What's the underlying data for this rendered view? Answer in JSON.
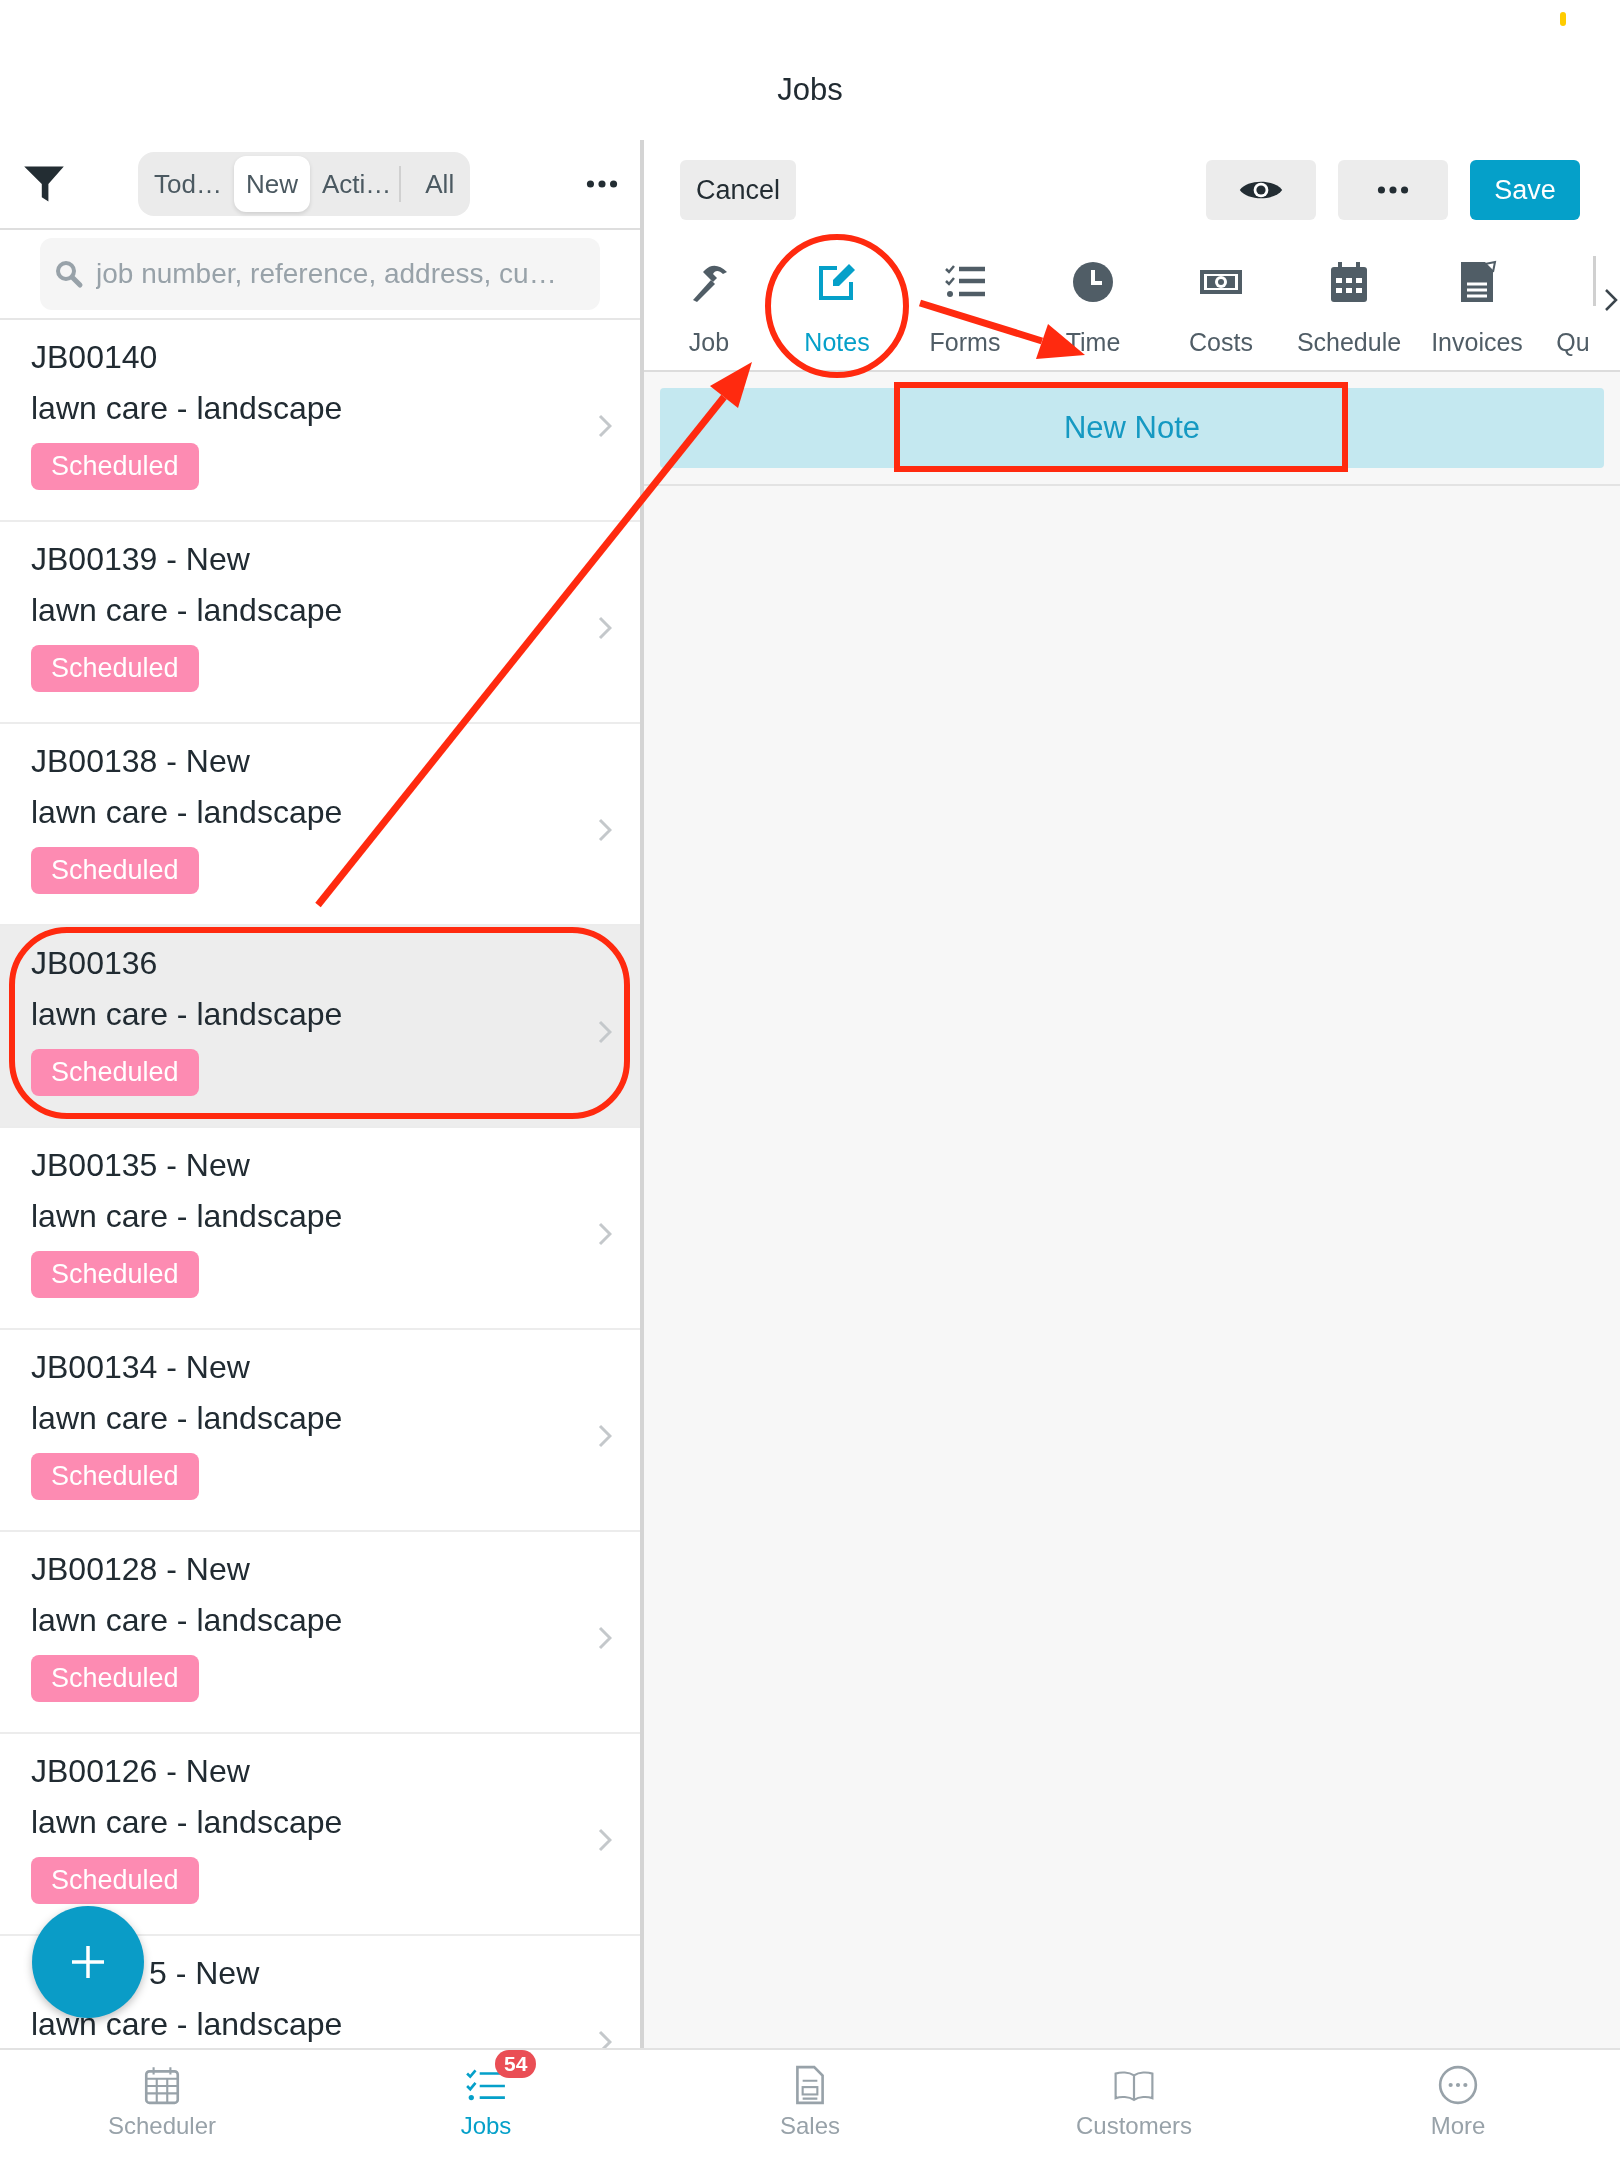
{
  "header": {
    "title": "Jobs"
  },
  "filter_tabs": [
    {
      "label": "Tod…",
      "selected": false
    },
    {
      "label": "New",
      "selected": true
    },
    {
      "label": "Acti…",
      "selected": false
    },
    {
      "label": "All",
      "selected": false
    }
  ],
  "search": {
    "placeholder": "job number, reference, address, cu…"
  },
  "jobs": [
    {
      "title": "JB00140",
      "description": "lawn care - landscape",
      "status": "Scheduled",
      "selected": false
    },
    {
      "title": "JB00139 - New",
      "description": "lawn care - landscape",
      "status": "Scheduled",
      "selected": false
    },
    {
      "title": "JB00138 - New",
      "description": "lawn care - landscape",
      "status": "Scheduled",
      "selected": false
    },
    {
      "title": "JB00136",
      "description": "lawn care - landscape",
      "status": "Scheduled",
      "selected": true
    },
    {
      "title": "JB00135 - New",
      "description": "lawn care - landscape",
      "status": "Scheduled",
      "selected": false
    },
    {
      "title": "JB00134 - New",
      "description": "lawn care - landscape",
      "status": "Scheduled",
      "selected": false
    },
    {
      "title": "JB00128 - New",
      "description": "lawn care - landscape",
      "status": "Scheduled",
      "selected": false
    },
    {
      "title": "JB00126 - New",
      "description": "lawn care - landscape",
      "status": "Scheduled",
      "selected": false
    },
    {
      "title": "5 - New",
      "description": "lawn care - landscape"
    }
  ],
  "toolbar": {
    "cancel": "Cancel",
    "save": "Save"
  },
  "tabs": [
    {
      "label": "Job",
      "kind": "hammer",
      "selected": false
    },
    {
      "label": "Notes",
      "kind": "edit",
      "selected": true
    },
    {
      "label": "Forms",
      "kind": "checklist",
      "selected": false
    },
    {
      "label": "Time",
      "kind": "clock",
      "selected": false
    },
    {
      "label": "Costs",
      "kind": "money",
      "selected": false
    },
    {
      "label": "Schedule",
      "kind": "calendar",
      "selected": false
    },
    {
      "label": "Invoices",
      "kind": "invoice",
      "selected": false
    },
    {
      "label": "Qu",
      "kind": "none",
      "selected": false
    }
  ],
  "new_note": "New Note",
  "nav": [
    {
      "label": "Scheduler",
      "kind": "calendar",
      "selected": false
    },
    {
      "label": "Jobs",
      "kind": "checklist",
      "selected": true,
      "badge": "54"
    },
    {
      "label": "Sales",
      "kind": "document",
      "selected": false
    },
    {
      "label": "Customers",
      "kind": "book",
      "selected": false
    },
    {
      "label": "More",
      "kind": "more",
      "selected": false
    }
  ]
}
